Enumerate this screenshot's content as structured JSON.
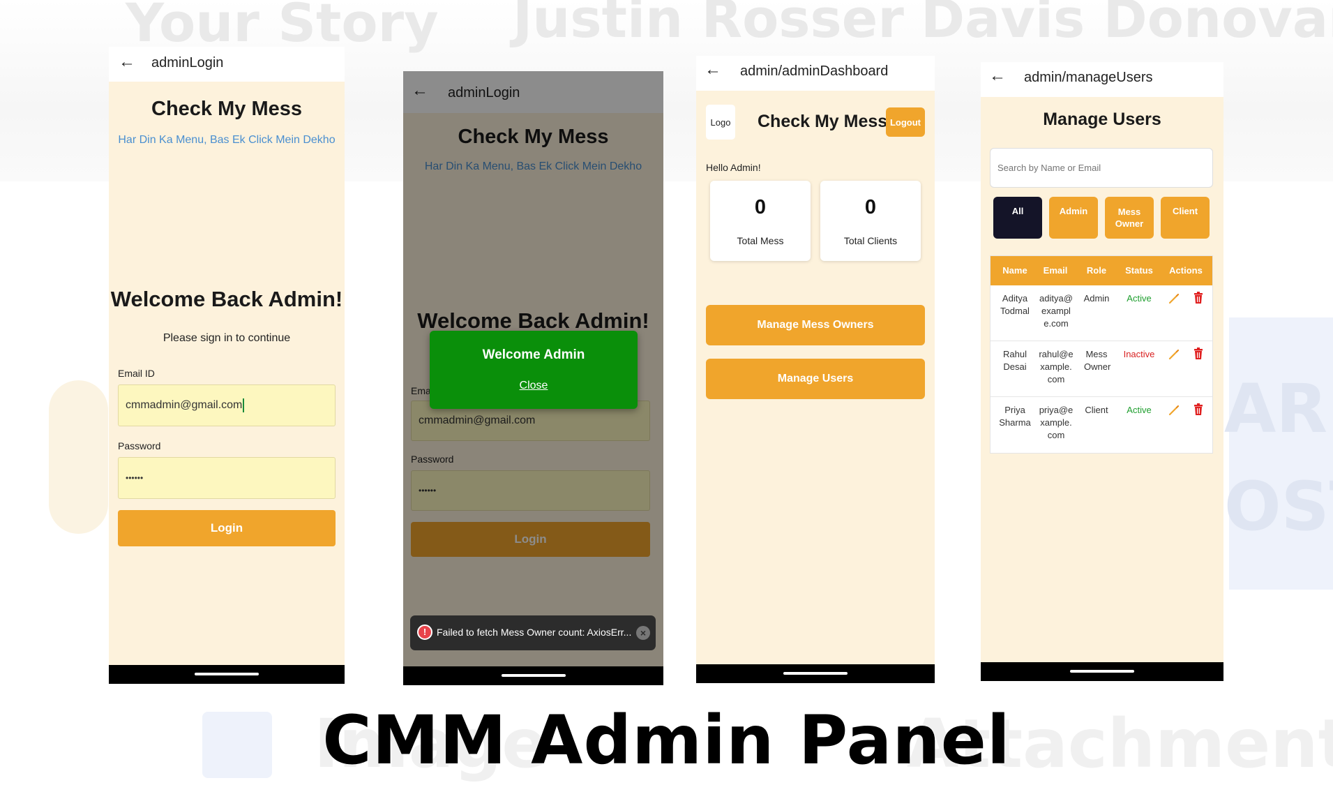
{
  "background_words": [
    "Your Story",
    "Justin Rosser",
    "Davis Donovan",
    "Image",
    "Attachment",
    "ARE",
    "OST"
  ],
  "caption": "CMM Admin Panel",
  "colors": {
    "accent": "#f0a52c",
    "page_bg": "#fdf2dc",
    "field_bg": "#fdf7bf",
    "tagline": "#4a8fd0",
    "success": "#0a8f0a",
    "active": "#1e9e2e",
    "inactive": "#d81f1f",
    "dark_chip": "#141428"
  },
  "screen1": {
    "route": "adminLogin",
    "app_title": "Check My Mess",
    "tagline": "Har Din Ka Menu, Bas Ek Click Mein Dekho",
    "welcome": "Welcome Back Admin!",
    "subtitle": "Please sign in to continue",
    "email_label": "Email ID",
    "email_value": "cmmadmin@gmail.com",
    "password_label": "Password",
    "password_value": "••••••",
    "login_label": "Login"
  },
  "screen2": {
    "route": "adminLogin",
    "app_title": "Check My Mess",
    "tagline": "Har Din Ka Menu, Bas Ek Click Mein Dekho",
    "welcome": "Welcome Back Admin!",
    "email_label": "Ema",
    "email_value": "cmmadmin@gmail.com",
    "password_label": "Password",
    "password_value": "••••••",
    "login_label": "Login",
    "popup_title": "Welcome Admin",
    "popup_close": "Close",
    "toast_text": "Failed to fetch Mess Owner count: AxiosErr..."
  },
  "screen3": {
    "route": "admin/adminDashboard",
    "logo": "Logo",
    "app_title": "Check My Mess",
    "logout": "Logout",
    "greeting": "Hello Admin!",
    "stats": [
      {
        "value": "0",
        "label": "Total Mess"
      },
      {
        "value": "0",
        "label": "Total Clients"
      }
    ],
    "actions": [
      "Manage Mess Owners",
      "Manage Users"
    ]
  },
  "screen4": {
    "route": "admin/manageUsers",
    "title": "Manage Users",
    "search_placeholder": "Search by Name or Email",
    "filters": [
      {
        "label": "All"
      },
      {
        "label": "Admin"
      },
      {
        "label": "Mess Owner"
      },
      {
        "label": "Client"
      }
    ],
    "columns": [
      "Name",
      "Email",
      "Role",
      "Status",
      "Actions"
    ],
    "rows": [
      {
        "name": "Aditya Todmal",
        "email": "aditya@example.com",
        "role": "Admin",
        "status": "Active"
      },
      {
        "name": "Rahul Desai",
        "email": "rahul@example.com",
        "role": "Mess Owner",
        "status": "Inactive"
      },
      {
        "name": "Priya Sharma",
        "email": "priya@example.com",
        "role": "Client",
        "status": "Active"
      }
    ]
  }
}
